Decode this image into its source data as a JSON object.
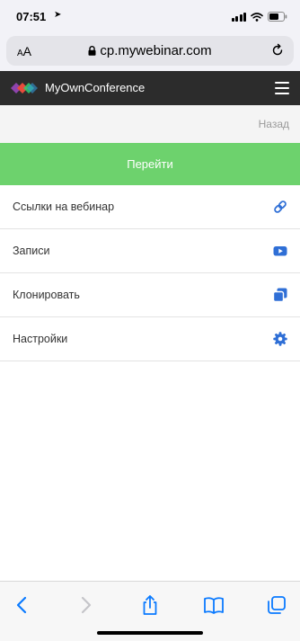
{
  "status_bar": {
    "time": "07:51"
  },
  "address_bar": {
    "text_size_label_small": "A",
    "text_size_label_large": "A",
    "url": "cp.mywebinar.com"
  },
  "header": {
    "brand": "MyOwnConference",
    "logo_colors": [
      "#8e44ad",
      "#e74c3c",
      "#2ecc71",
      "#3498db"
    ]
  },
  "nav": {
    "back_label": "Назад"
  },
  "main": {
    "go_button_label": "Перейти",
    "menu_items": [
      {
        "label": "Ссылки на вебинар",
        "icon": "link-icon"
      },
      {
        "label": "Записи",
        "icon": "youtube-icon"
      },
      {
        "label": "Клонировать",
        "icon": "clone-icon"
      },
      {
        "label": "Настройки",
        "icon": "gear-icon"
      }
    ]
  },
  "colors": {
    "accent_green": "#6dd26d",
    "icon_blue": "#2f6fd6",
    "header_bg": "#2c2c2c",
    "safari_blue": "#0a7aff"
  },
  "toolbar": {
    "icons": [
      "back-icon",
      "forward-icon",
      "share-icon",
      "bookmarks-icon",
      "tabs-icon"
    ]
  }
}
